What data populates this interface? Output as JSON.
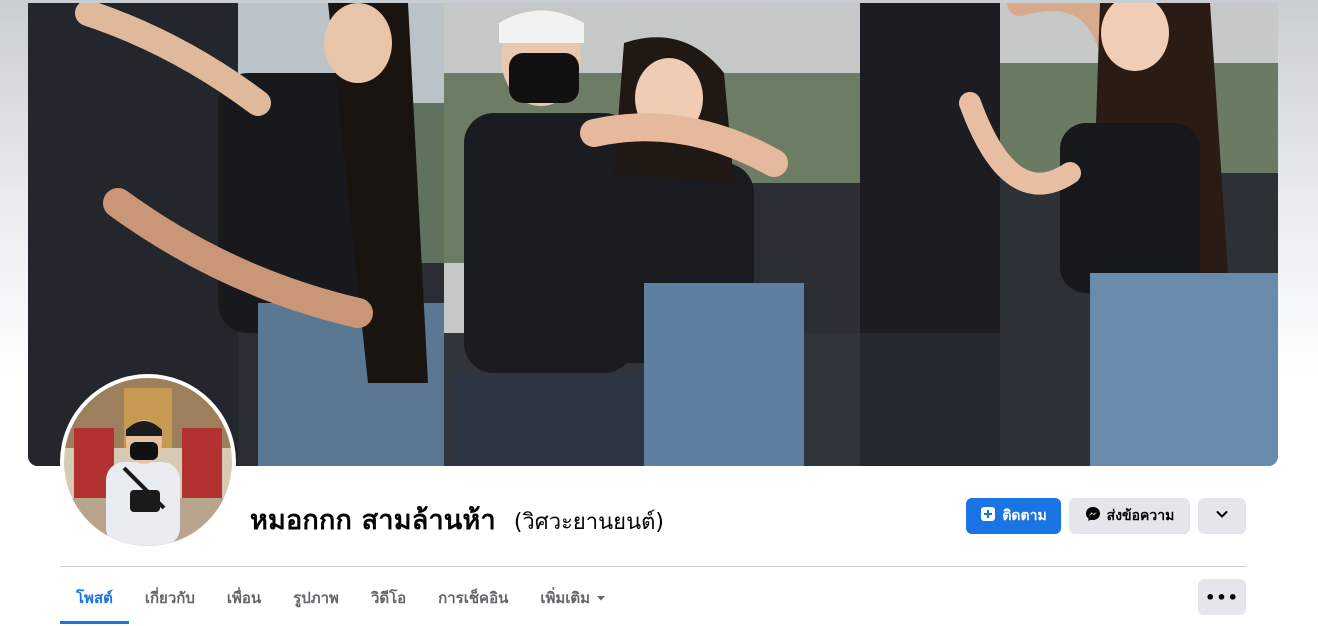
{
  "profile": {
    "name": "หมอกกก สามล้านห้า",
    "alternate_name": "(วิศวะยานยนต์)"
  },
  "actions": {
    "follow_label": "ติดตาม",
    "message_label": "ส่งข้อความ",
    "follow_icon": "add-friend-icon",
    "message_icon": "messenger-icon",
    "dropdown_icon": "chevron-down-icon"
  },
  "tabs": [
    {
      "label": "โพสต์",
      "active": true
    },
    {
      "label": "เกี่ยวกับ",
      "active": false
    },
    {
      "label": "เพื่อน",
      "active": false
    },
    {
      "label": "รูปภาพ",
      "active": false
    },
    {
      "label": "วิดีโอ",
      "active": false
    },
    {
      "label": "การเช็คอิน",
      "active": false
    },
    {
      "label": "เพิ่มเติม",
      "active": false
    }
  ],
  "more_menu": {
    "label": "•••",
    "icon": "ellipsis-icon"
  },
  "colors": {
    "accent": "#1b74e4",
    "button_gray": "#e4e6eb",
    "text_primary": "#050505",
    "text_secondary": "#65676b"
  }
}
